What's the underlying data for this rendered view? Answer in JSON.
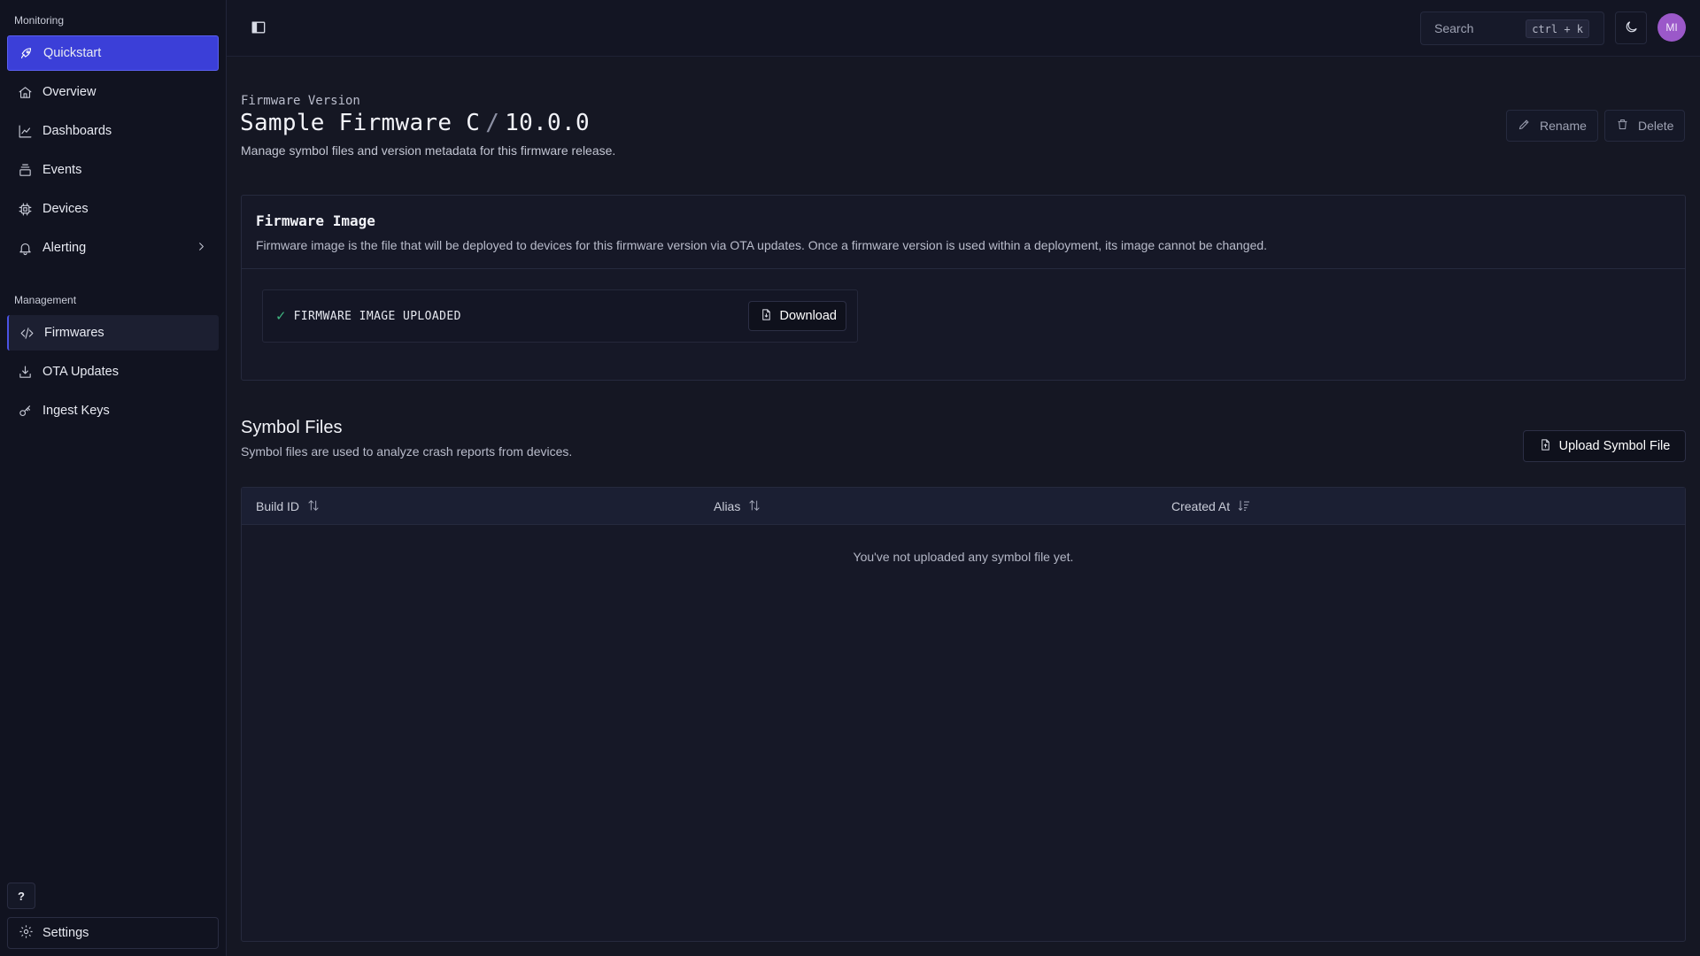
{
  "sidebar": {
    "monitoring_label": "Monitoring",
    "management_label": "Management",
    "items": [
      {
        "label": "Quickstart",
        "icon": "rocket-icon"
      },
      {
        "label": "Overview",
        "icon": "home-icon"
      },
      {
        "label": "Dashboards",
        "icon": "chart-line-icon"
      },
      {
        "label": "Events",
        "icon": "layers-icon"
      },
      {
        "label": "Devices",
        "icon": "chip-icon"
      },
      {
        "label": "Alerting",
        "icon": "bell-icon"
      },
      {
        "label": "Firmwares",
        "icon": "code-icon"
      },
      {
        "label": "OTA Updates",
        "icon": "download-tray-icon"
      },
      {
        "label": "Ingest Keys",
        "icon": "key-icon"
      }
    ],
    "help_label": "?",
    "settings_label": "Settings"
  },
  "topbar": {
    "search_placeholder": "Search",
    "search_shortcut": "ctrl + k",
    "avatar_initials": "MI"
  },
  "page": {
    "eyebrow": "Firmware Version",
    "title_name": "Sample Firmware C",
    "title_sep": "/",
    "title_version": "10.0.0",
    "subtitle": "Manage symbol files and version metadata for this firmware release.",
    "rename_label": "Rename",
    "delete_label": "Delete"
  },
  "firmware_image": {
    "title": "Firmware Image",
    "description": "Firmware image is the file that will be deployed to devices for this firmware version via OTA updates. Once a firmware version is used within a deployment, its image cannot be changed.",
    "status": "FIRMWARE IMAGE UPLOADED",
    "download_label": "Download"
  },
  "symbol_files": {
    "title": "Symbol Files",
    "description": "Symbol files are used to analyze crash reports from devices.",
    "upload_label": "Upload Symbol File",
    "columns": [
      "Build ID",
      "Alias",
      "Created At"
    ],
    "empty_message": "You've not uploaded any symbol file yet."
  },
  "colors": {
    "accent": "#3b3fd8",
    "background": "#151723",
    "success": "#3fb37f",
    "avatar": "#9b58c9"
  }
}
